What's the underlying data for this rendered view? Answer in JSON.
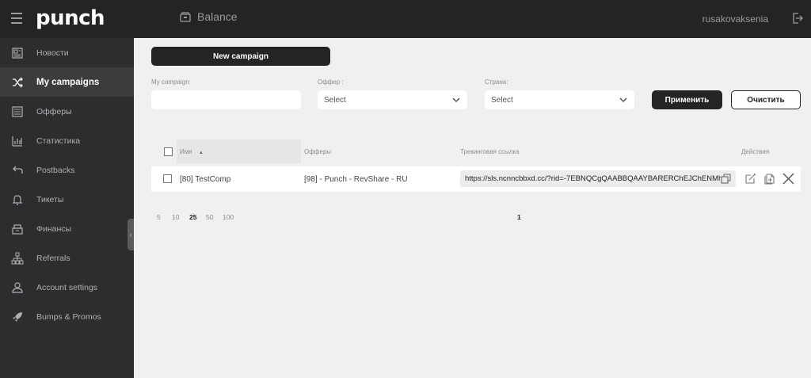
{
  "header": {
    "logo": "punch",
    "balance_label": "Balance",
    "username": "rusakovaksenia"
  },
  "sidebar": {
    "items": [
      {
        "label": "Новости",
        "icon": "newspaper-icon",
        "active": false
      },
      {
        "label": "My campaigns",
        "icon": "shuffle-icon",
        "active": true
      },
      {
        "label": "Офферы",
        "icon": "list-icon",
        "active": false
      },
      {
        "label": "Статистика",
        "icon": "bar-chart-icon",
        "active": false
      },
      {
        "label": "Postbacks",
        "icon": "return-arrow-icon",
        "active": false
      },
      {
        "label": "Тикеты",
        "icon": "bell-icon",
        "active": false
      },
      {
        "label": "Финансы",
        "icon": "cash-register-icon",
        "active": false
      },
      {
        "label": "Referrals",
        "icon": "hierarchy-icon",
        "active": false
      },
      {
        "label": "Account settings",
        "icon": "user-icon",
        "active": false
      },
      {
        "label": "Bumps & Promos",
        "icon": "rocket-icon",
        "active": false
      }
    ]
  },
  "toolbar": {
    "new_campaign_label": "New campaign"
  },
  "filters": {
    "campaign_label": "My campaign:",
    "campaign_value": "",
    "offer_label": "Оффер :",
    "offer_value": "Select",
    "country_label": "Страна:",
    "country_value": "Select",
    "apply_label": "Применить",
    "clear_label": "Очистить"
  },
  "table": {
    "columns": {
      "name": "Имя",
      "offers": "Офферы",
      "tracking_link": "Трекинговая ссылка",
      "actions": "Действия"
    },
    "rows": [
      {
        "name": "[80] TestComp",
        "offer": "[98] - Punch - RevShare - RU",
        "tracking_link": "https://sls.ncnncbbxd.cc/?rid=-7EBNQCgQAABBQAAYBARERChEJChENMh"
      }
    ]
  },
  "pagination": {
    "page_sizes": [
      "5",
      "10",
      "25",
      "50",
      "100"
    ],
    "selected_page_size": "25",
    "current_page": "1"
  },
  "colors": {
    "topbar": "#222426",
    "sidebar": "#2b2d2f",
    "active_item": "#3a3c3e",
    "primary_button": "#222426"
  }
}
